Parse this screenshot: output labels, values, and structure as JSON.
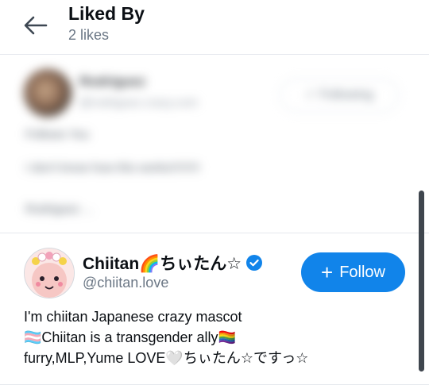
{
  "header": {
    "title": "Liked By",
    "subtitle": "2 likes",
    "back_icon": "arrow-left-icon"
  },
  "blurred_entry": {
    "name": "Rodriguez",
    "handle": "@rodriguez.crazy.com",
    "button_label": "✓ Following",
    "lines": [
      "Follows You",
      "I don't know how this works!!!!!!!!!",
      "Rodriguez ..."
    ]
  },
  "user": {
    "display_name": "Chiitan🌈ちぃたん☆",
    "handle": "@chiitan.love",
    "verified": true,
    "follow_label": "Follow",
    "bio": [
      "I'm chiitan Japanese crazy mascot",
      "🏳️‍⚧️Chiitan is a transgender ally🏳️‍🌈",
      "furry,MLP,Yume LOVE🤍ちぃたん☆ですっ☆"
    ]
  },
  "colors": {
    "accent": "#1184ea",
    "muted_text": "#6b7785",
    "divider": "#e6e9ee"
  }
}
